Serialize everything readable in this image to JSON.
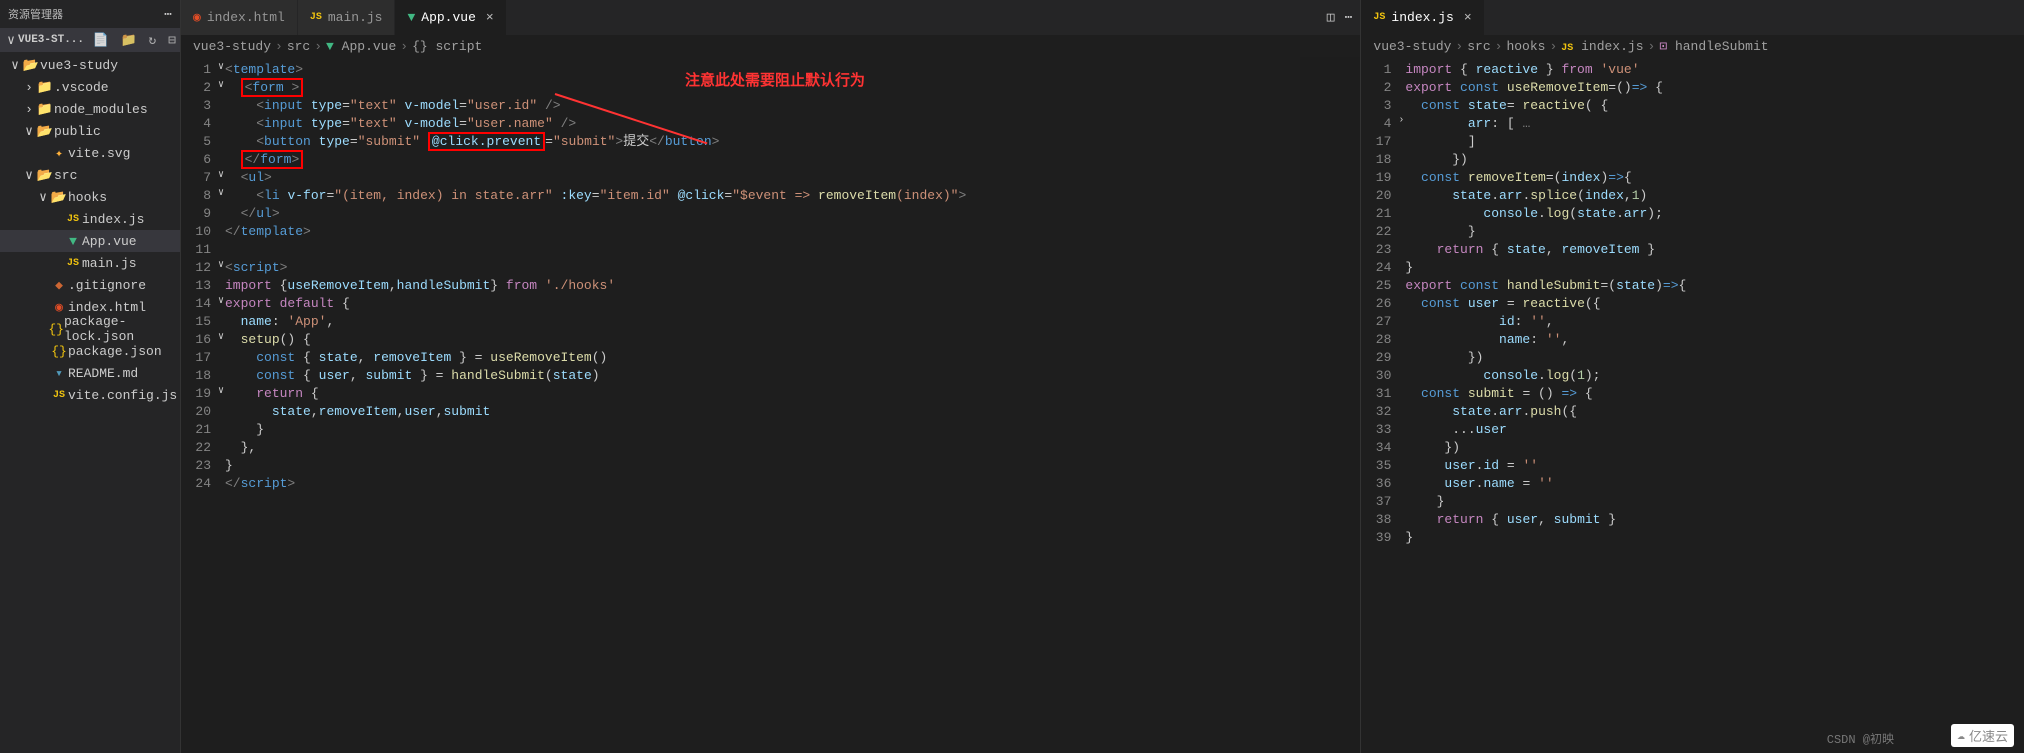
{
  "sidebar": {
    "title": "资源管理器",
    "project": "VUE3-ST...",
    "tree": [
      {
        "d": 0,
        "c": "∨",
        "ico": "folder-o",
        "lbl": "vue3-study"
      },
      {
        "d": 1,
        "c": "›",
        "ico": "folder",
        "lbl": ".vscode"
      },
      {
        "d": 1,
        "c": "›",
        "ico": "folder",
        "lbl": "node_modules"
      },
      {
        "d": 1,
        "c": "∨",
        "ico": "folder-o",
        "lbl": "public"
      },
      {
        "d": 2,
        "c": "",
        "ico": "svg",
        "lbl": "vite.svg"
      },
      {
        "d": 1,
        "c": "∨",
        "ico": "folder-o",
        "lbl": "src"
      },
      {
        "d": 2,
        "c": "∨",
        "ico": "folder-o",
        "lbl": "hooks"
      },
      {
        "d": 3,
        "c": "",
        "ico": "js",
        "lbl": "index.js"
      },
      {
        "d": 3,
        "c": "",
        "ico": "vue",
        "lbl": "App.vue",
        "active": true
      },
      {
        "d": 3,
        "c": "",
        "ico": "js",
        "lbl": "main.js"
      },
      {
        "d": 2,
        "c": "",
        "ico": "git",
        "lbl": ".gitignore"
      },
      {
        "d": 2,
        "c": "",
        "ico": "html",
        "lbl": "index.html"
      },
      {
        "d": 2,
        "c": "",
        "ico": "json",
        "lbl": "package-lock.json"
      },
      {
        "d": 2,
        "c": "",
        "ico": "json",
        "lbl": "package.json"
      },
      {
        "d": 2,
        "c": "",
        "ico": "md",
        "lbl": "README.md"
      },
      {
        "d": 2,
        "c": "",
        "ico": "js",
        "lbl": "vite.config.js"
      }
    ]
  },
  "tabs1": [
    {
      "ico": "html",
      "lbl": "index.html"
    },
    {
      "ico": "js",
      "lbl": "main.js"
    },
    {
      "ico": "vue",
      "lbl": "App.vue",
      "active": true,
      "close": true
    }
  ],
  "tabs2": [
    {
      "ico": "js",
      "lbl": "index.js",
      "active": true,
      "close": true
    }
  ],
  "crumbs1": [
    "vue3-study",
    "src",
    "App.vue",
    "{} script"
  ],
  "crumbs2": [
    "vue3-study",
    "src",
    "hooks",
    "index.js",
    "handleSubmit"
  ],
  "annotation": "注意此处需要阻止默认行为",
  "left_lines": [
    "1",
    "2",
    "3",
    "4",
    "5",
    "6",
    "7",
    "8",
    "9",
    "10",
    "11",
    "12",
    "13",
    "14",
    "15",
    "16",
    "17",
    "18",
    "19",
    "20",
    "21",
    "22",
    "23",
    "24"
  ],
  "right_lines": [
    "1",
    "2",
    "3",
    "4",
    "17",
    "18",
    "19",
    "20",
    "21",
    "22",
    "23",
    "24",
    "25",
    "26",
    "27",
    "28",
    "29",
    "30",
    "31",
    "32",
    "33",
    "34",
    "35",
    "36",
    "37",
    "38",
    "39"
  ],
  "code_left": {
    "l1": "<template>",
    "l2_open": "<form >",
    "l3": "<input type=\"text\" v-model=\"user.id\" />",
    "l4": "<input type=\"text\" v-model=\"user.name\" />",
    "l5a": "<button type=\"submit\" ",
    "l5b": "@click.prevent",
    "l5c": "=\"submit\">提交</button>",
    "l6": "</form>",
    "l7": "<ul>",
    "l8": "<li v-for=\"(item, index) in state.arr\" :key=\"item.id\" @click=\"$event => removeItem(index)\">",
    "l9": "</ul>",
    "l10": "</template>",
    "l12": "<script>",
    "l13": "import {useRemoveItem,handleSubmit} from './hooks'",
    "l14": "export default {",
    "l15": "name: 'App',",
    "l16": "setup() {",
    "l17": "const { state, removeItem } = useRemoveItem()",
    "l18": "const { user, submit } = handleSubmit(state)",
    "l19": "return {",
    "l20": "state,removeItem,user,submit",
    "l21": "}",
    "l22": "},",
    "l23": "}",
    "l24": "</script>"
  },
  "watermark": "CSDN @初映",
  "watermark2": "亿速云"
}
